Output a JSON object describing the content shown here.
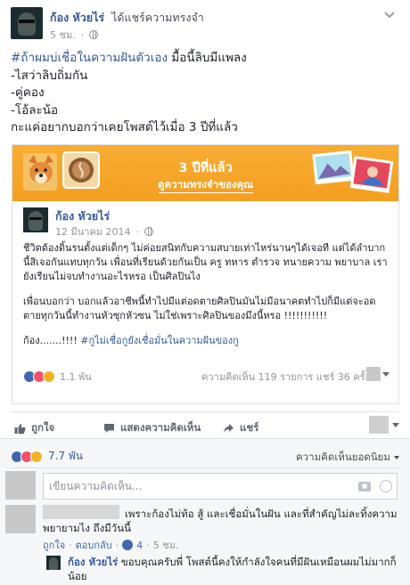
{
  "post": {
    "author": "ก้อง หัวยไร่",
    "action": "ได้แชร์ความทรงจำ",
    "time": "5 ชม.",
    "lines": [
      "#ถ้าผมบ่เชื่อในความฝันตัวเอง",
      " มื้อนี้ลิบมีแพลง",
      "-ไสว่าลิบถิ่มกัน",
      "-คู่คอง",
      "-โอ้ละน้อ",
      "กะแค่อยากบอกว่าเคยโพสต์ไว้เมื่อ 3 ปีที่แล้ว"
    ]
  },
  "memory": {
    "title": "3 ปีที่แล้ว",
    "link": "ดูความทรงจำของคุณ",
    "inner": {
      "author": "ก้อง หัวยไร่",
      "date": "12 มีนาคม 2014",
      "para1": "ชีวิตต้องดิ้นรนตั้งแต่เด็กๆ ไม่ค่อยสนิทกับความสบายเท่าไหร่นานๆได้เจอที แต่ได้ลำบากนี้สิเจอกันแทบทุกวัน เพื่อนที่เรียนด้วยกันเป็น ครู ทหาร ตำรวจ ทนายความ พยาบาล เรายังเรียนไม่จบทำงานอะไรหรอ เป็นศิลปินไง",
      "para2": "เพื่อนบอกว่า บอกแล้วอาชีพนี้ทำไปมีแต่อดตายศิลปินมันไม่มีอนาคตทำไปก็มีแต่จะอดตายทุกวันนี้ทำงานหัวซุกหัวซน ไม่ใช่เพราะศิลปินของมึงนี้หรอ !!!!!!!!!!!",
      "para3_prefix": "ก้อง.......!!!! ",
      "para3_hashtag": "#กูไม่เชื่อกูยังเชื่อมั่นในความฝันของกู",
      "reaction_count": "1.1 พัน",
      "stats": "ความคิดเห็น 119 รายการ  แชร์ 36 ครั้ง"
    }
  },
  "actions": {
    "like": "ถูกใจ",
    "comment": "แสดงความคิดเห็น",
    "share": "แชร์"
  },
  "summary": {
    "reaction_count": "7.7 พัน",
    "sort_label": "ความคิดเห็นยอดนิยม"
  },
  "compose": {
    "placeholder": "เขียนความคิดเห็น..."
  },
  "comment": {
    "text": "เพราะก้องไม่ท้อ สู้ และเชื่อมั่นในฝัน และที่สำคัญไม่ละทิ้งความพยายามไง ถึงมีวันนี้",
    "like": "ถูกใจ",
    "reply": "ตอบกลับ",
    "likes": "4",
    "time": "5 ชม."
  },
  "reply": {
    "author": "ก้อง หัวยไร่",
    "text": " ขอบคุณครับพี่ โพสต์นี้คงให้กำลังใจคนที่มีฝันเหมือนผมไม่มากก็น้อย"
  },
  "colors": {
    "link_blue": "#365899",
    "banner_orange": "#f5a623",
    "like_blue": "#4267b2",
    "love_red": "#f25268",
    "wow_yellow": "#f7b125"
  }
}
